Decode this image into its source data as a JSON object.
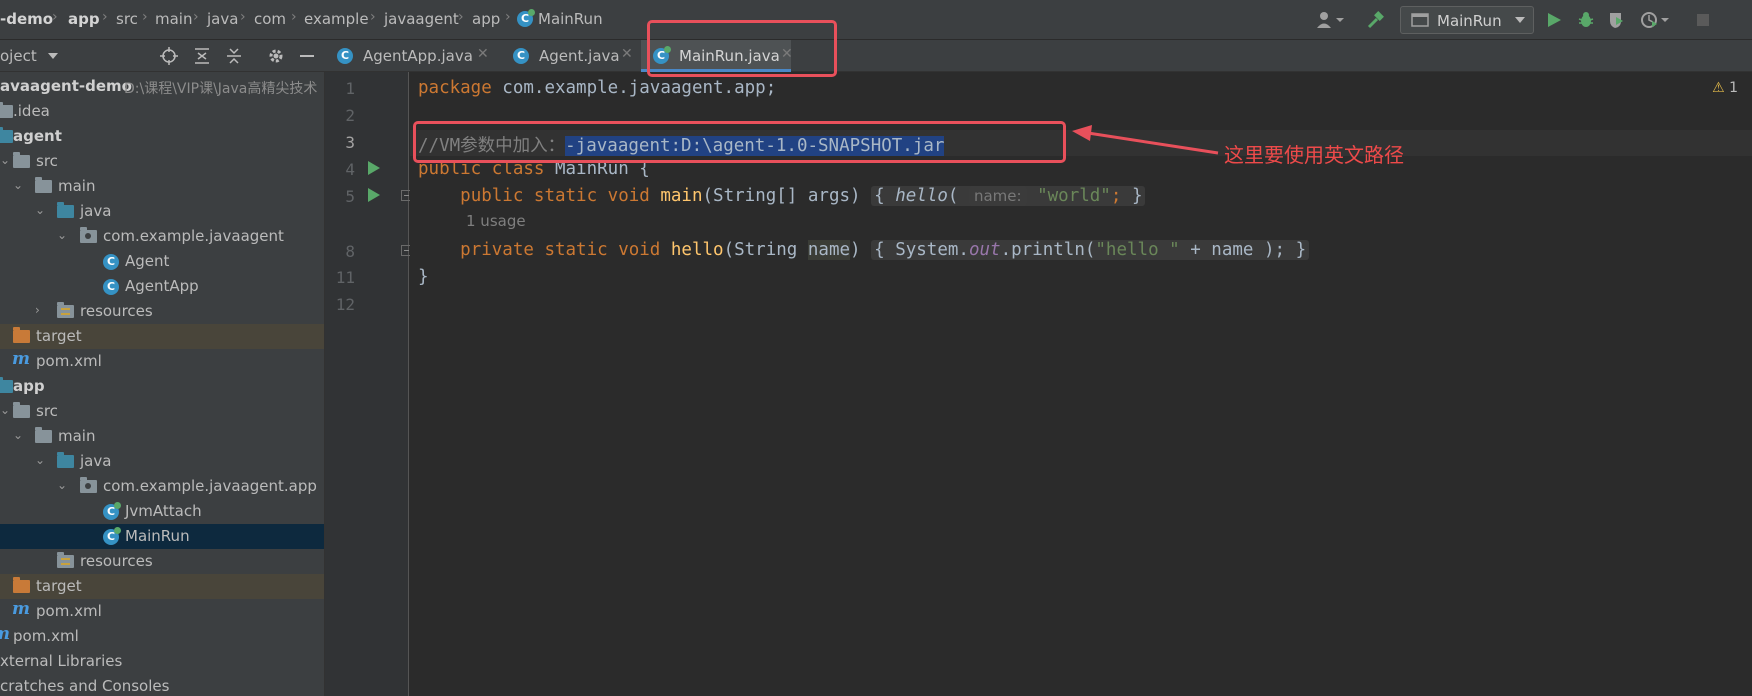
{
  "breadcrumb": [
    "-demo",
    "app",
    "src",
    "main",
    "java",
    "com",
    "example",
    "javaagent",
    "app",
    "MainRun"
  ],
  "toolbar": {
    "run_config": "MainRun"
  },
  "project_panel": {
    "title": "oject"
  },
  "tabs": [
    {
      "label": "AgentApp.java",
      "active": false
    },
    {
      "label": "Agent.java",
      "active": false
    },
    {
      "label": "MainRun.java",
      "active": true
    }
  ],
  "tree": {
    "root": {
      "label": "avaagent-demo",
      "path": "D:\\课程\\VIP课\\Java高精尖技术"
    },
    "idea": ".idea",
    "agent": "agent",
    "agent_src": "src",
    "agent_main": "main",
    "agent_java": "java",
    "agent_pkg": "com.example.javaagent",
    "agent_cls1": "Agent",
    "agent_cls2": "AgentApp",
    "agent_resources": "resources",
    "agent_target": "target",
    "agent_pom": "pom.xml",
    "app": "app",
    "app_src": "src",
    "app_main": "main",
    "app_java": "java",
    "app_pkg": "com.example.javaagent.app",
    "app_cls1": "JvmAttach",
    "app_cls2": "MainRun",
    "app_resources": "resources",
    "app_target": "target",
    "app_pom": "pom.xml",
    "root_pom": "pom.xml",
    "ext_libs": "xternal Libraries",
    "scratches": "cratches and Consoles"
  },
  "editor": {
    "line_numbers": [
      "1",
      "2",
      "3",
      "4",
      "5",
      "8",
      "11",
      "12"
    ],
    "warning_count": "1",
    "code": {
      "l1_kw": "package",
      "l1_rest": " com.example.javaagent.app;",
      "l3_comment": "//VM参数中加入：",
      "l3_selected": "-javaagent:D:\\agent-1.0-SNAPSHOT.jar",
      "l4_kw": "public class",
      "l4_rest": " MainRun {",
      "l5_kw": "public static void",
      "l5_fn": "main",
      "l5_params": "(String[] args)",
      "l5_call": "hello",
      "l5_hint": "name:",
      "l5_str": "\"world\"",
      "usage": "1 usage",
      "l8_kw": "private static void",
      "l8_fn": "hello",
      "l8_params_a": "(String ",
      "l8_param_name": "name",
      "l8_sys": "System.",
      "l8_out": "out",
      "l8_println": ".println(",
      "l8_str": "\"hello \"",
      "l8_tail": " + name );",
      "l11": "}"
    }
  },
  "annotation": {
    "text": "这里要使用英文路径"
  }
}
